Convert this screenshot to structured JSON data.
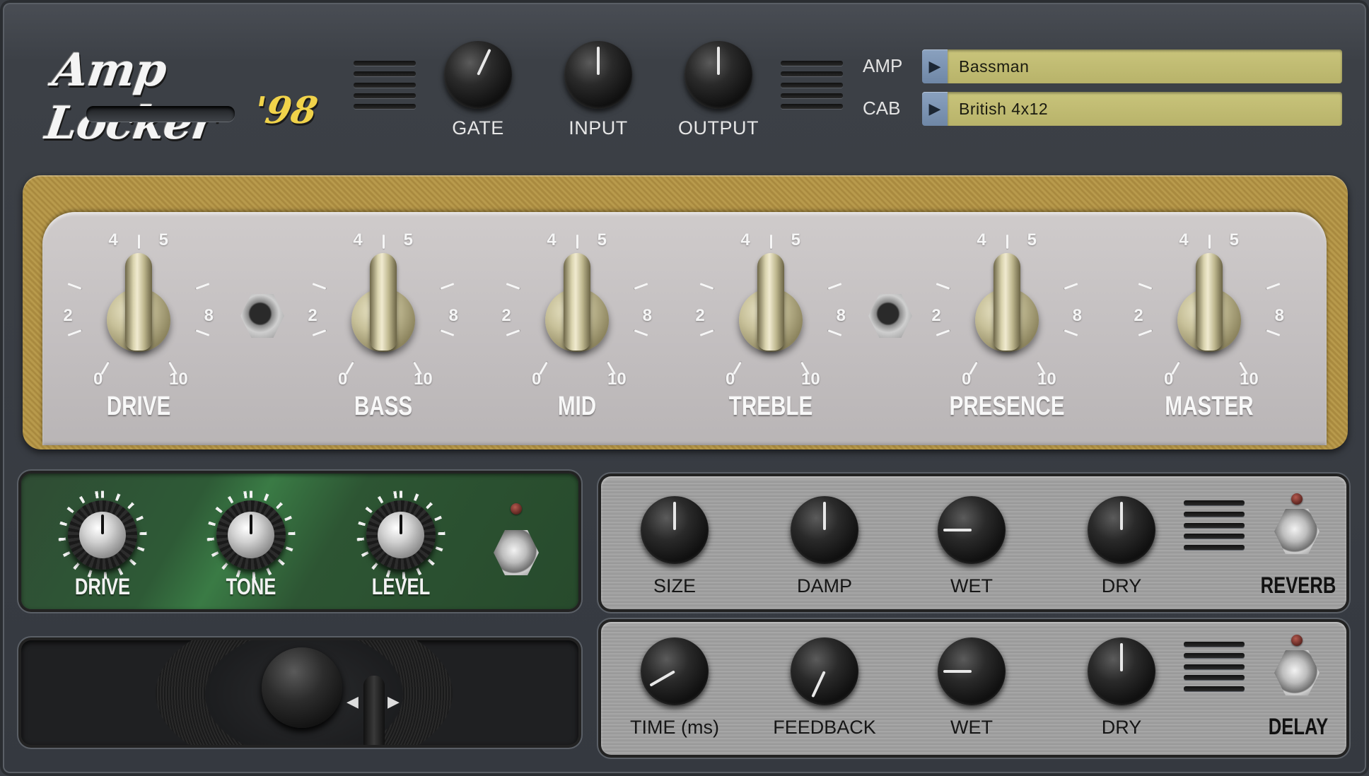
{
  "app": {
    "title": "Amp Locker",
    "version": "'98"
  },
  "top_controls": [
    {
      "label": "GATE",
      "angle": 205
    },
    {
      "label": "INPUT",
      "angle": 180
    },
    {
      "label": "OUTPUT",
      "angle": 180
    }
  ],
  "presets": {
    "amp": {
      "label": "AMP",
      "value": "Bassman"
    },
    "cab": {
      "label": "CAB",
      "value": "British 4x12"
    }
  },
  "amp_controls": [
    {
      "label": "DRIVE",
      "value": 5
    },
    {
      "label": "BASS",
      "value": 5
    },
    {
      "label": "MID",
      "value": 5
    },
    {
      "label": "TREBLE",
      "value": 5
    },
    {
      "label": "PRESENCE",
      "value": 5
    },
    {
      "label": "MASTER",
      "value": 5
    }
  ],
  "scale_labels": {
    "zero": "0",
    "two": "2",
    "four": "4",
    "five": "5",
    "eight": "8",
    "ten": "10"
  },
  "pedal": {
    "knobs": [
      {
        "label": "DRIVE"
      },
      {
        "label": "TONE"
      },
      {
        "label": "LEVEL"
      }
    ]
  },
  "reverb": {
    "name": "REVERB",
    "knobs": [
      {
        "label": "SIZE",
        "angle": 180
      },
      {
        "label": "DAMP",
        "angle": 180
      },
      {
        "label": "WET",
        "angle": 90
      },
      {
        "label": "DRY",
        "angle": 180
      }
    ]
  },
  "delay": {
    "name": "DELAY",
    "knobs": [
      {
        "label": "TIME (ms)",
        "angle": 60
      },
      {
        "label": "FEEDBACK",
        "angle": 25
      },
      {
        "label": "WET",
        "angle": 90
      },
      {
        "label": "DRY",
        "angle": 180
      }
    ]
  },
  "colors": {
    "tweed": "#b0924a",
    "preset_field": "#c3be73",
    "preset_arrow": "#7d94b2",
    "pedal_green": "#2e5a36"
  }
}
